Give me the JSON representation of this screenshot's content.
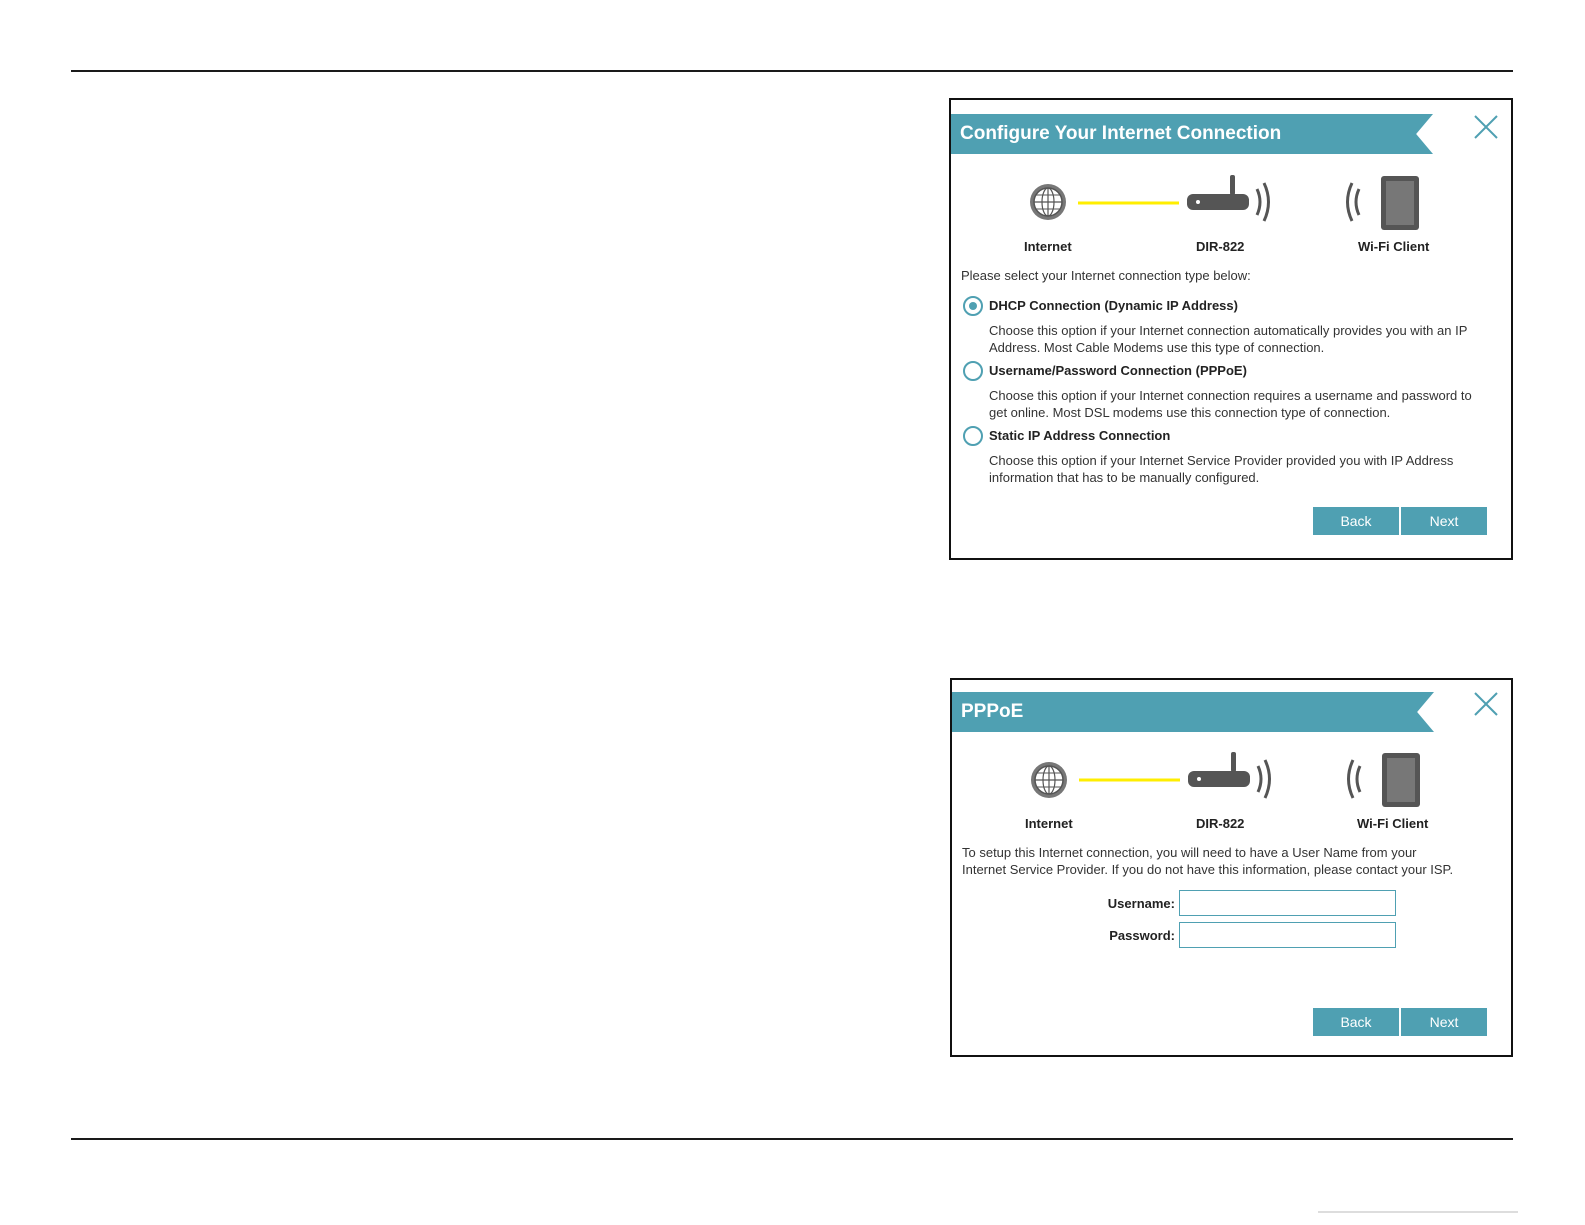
{
  "dialog1": {
    "title": "Configure Your Internet Connection",
    "labels": {
      "internet": "Internet",
      "router": "DIR-822",
      "client": "Wi-Fi Client"
    },
    "intro": "Please select your Internet connection type below:",
    "options": [
      {
        "title": "DHCP Connection (Dynamic IP Address)",
        "desc": "Choose this option if your Internet connection automatically provides you with an IP Address. Most Cable Modems use this type of connection.",
        "checked": true
      },
      {
        "title": "Username/Password Connection (PPPoE)",
        "desc": "Choose this option if your Internet connection requires a username and password to get online. Most DSL modems use this connection type of connection.",
        "checked": false
      },
      {
        "title": "Static IP Address Connection",
        "desc": "Choose this option if your Internet Service Provider provided you with IP Address information that has to be manually configured.",
        "checked": false
      }
    ],
    "back_label": "Back",
    "next_label": "Next"
  },
  "dialog2": {
    "title": "PPPoE",
    "labels": {
      "internet": "Internet",
      "router": "DIR-822",
      "client": "Wi-Fi Client"
    },
    "intro": "To setup this Internet connection, you will need to have a User Name from your Internet Service Provider. If you do not have this information, please contact your ISP.",
    "username_label": "Username:",
    "username_value": "",
    "password_label": "Password:",
    "password_value": "",
    "back_label": "Back",
    "next_label": "Next"
  },
  "colors": {
    "accent": "#4fa0b2",
    "link_line": "#ffee00",
    "device": "#555555"
  },
  "icons": [
    "close-icon",
    "globe-icon",
    "router-icon",
    "wifi-waves-icon",
    "tablet-icon"
  ]
}
